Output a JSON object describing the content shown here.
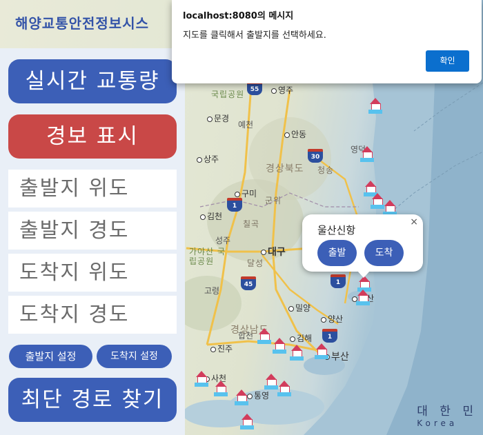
{
  "app_title": "해양교통안전정보시스",
  "alert": {
    "origin": "localhost:8080의 메시지",
    "message": "지도를 클릭해서 출발지를 선택하세요.",
    "ok_label": "확인"
  },
  "panel": {
    "traffic_button": "실시간 교통량",
    "warning_button": "경보 표시",
    "departure_lat_placeholder": "출발지 위도",
    "departure_lng_placeholder": "출발지 경도",
    "arrival_lat_placeholder": "도착지 위도",
    "arrival_lng_placeholder": "도착지 경도",
    "set_departure_button": "출발지 설정",
    "set_arrival_button": "도착지 설정",
    "shortest_route_button": "최단 경로 찾기"
  },
  "popup": {
    "title": "울산신항",
    "close_icon": "×",
    "departure_button": "출발",
    "arrival_button": "도착"
  },
  "map": {
    "cities": [
      "영주",
      "문경",
      "예천",
      "안동",
      "상주",
      "구미",
      "김천",
      "대구",
      "성주",
      "고령",
      "합천",
      "밀양",
      "양산",
      "김해",
      "부산",
      "진주",
      "사천",
      "통영",
      "영덕",
      "울산"
    ],
    "regions": [
      "경상북도",
      "경상남도",
      "군위",
      "칠곡",
      "달성",
      "청송",
      "가야산 국립공원",
      "국립공원"
    ],
    "routes": [
      "55",
      "30",
      "1",
      "45",
      "1",
      "1"
    ],
    "country_label": "대 한 민",
    "country_label_en": "Korea",
    "colors": {
      "port_roof": "#d23c5c",
      "port_base": "#58c2ee",
      "route_shield": "#2c4f9e"
    }
  }
}
